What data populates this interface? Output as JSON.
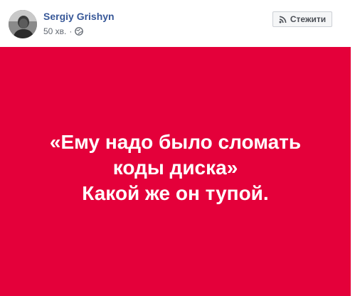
{
  "post": {
    "author": "Sergiy Grishyn",
    "time": "50 хв.",
    "separator": "·",
    "privacy_icon": "globe-icon",
    "follow_icon": "rss-icon",
    "follow_label": "Стежити"
  },
  "card": {
    "background_color": "#e4003a",
    "text_color": "#ffffff",
    "lines": [
      "«Ему надо было сломать",
      "коды диска»",
      "Какой же он тупой."
    ]
  },
  "colors": {
    "author_link": "#385898",
    "meta_text": "#616770"
  }
}
